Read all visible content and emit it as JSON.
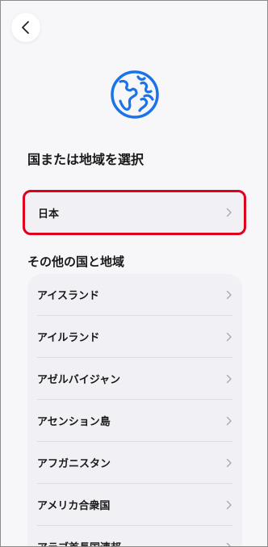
{
  "header": {
    "back_icon": "chevron-left-icon"
  },
  "hero": {
    "icon": "globe-icon",
    "accent": "#1a73e8"
  },
  "page_title": "国または地域を選択",
  "selected": {
    "label": "日本",
    "highlight_color": "#e0001b"
  },
  "section_title": "その他の国と地域",
  "countries": [
    {
      "label": "アイスランド"
    },
    {
      "label": "アイルランド"
    },
    {
      "label": "アゼルバイジャン"
    },
    {
      "label": "アセンション島"
    },
    {
      "label": "アフガニスタン"
    },
    {
      "label": "アメリカ合衆国"
    },
    {
      "label": "アラブ首長国連邦"
    }
  ]
}
